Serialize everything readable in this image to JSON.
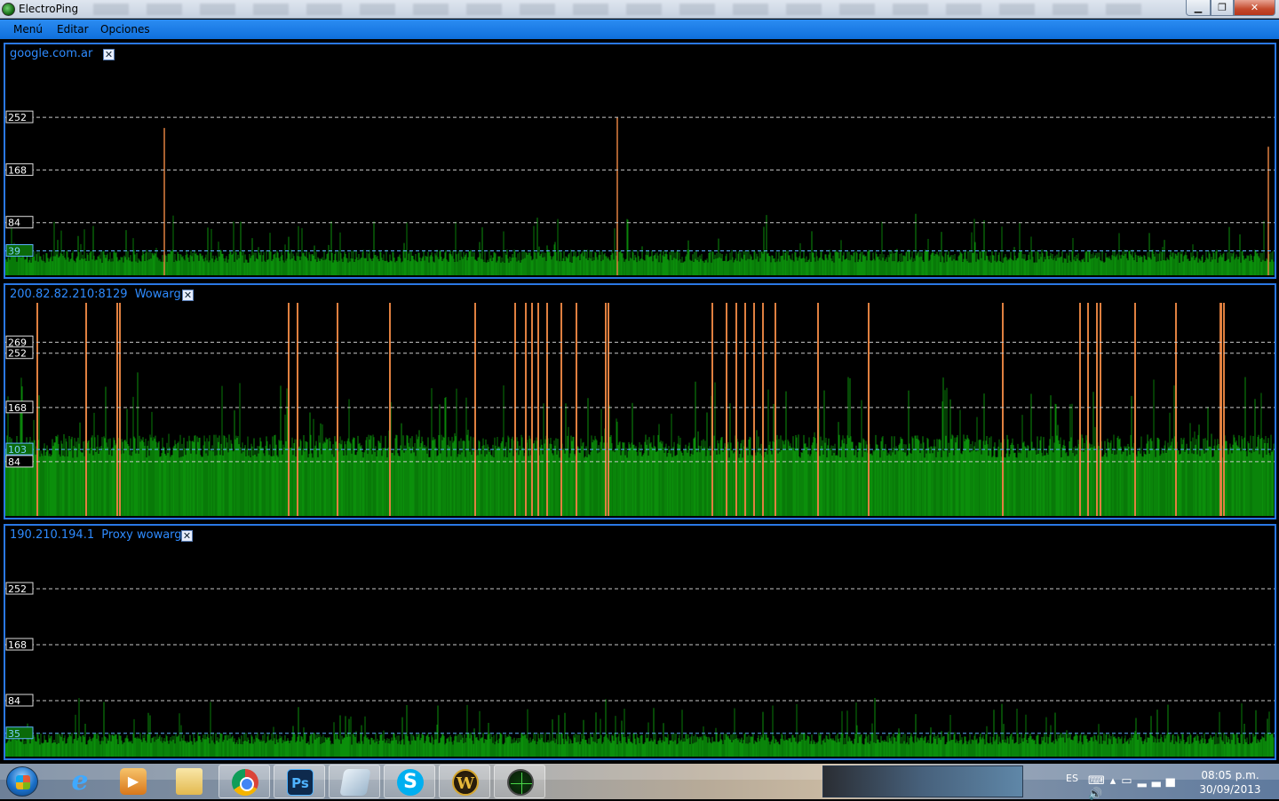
{
  "window": {
    "title": "ElectroPing"
  },
  "menu": {
    "items": [
      "Menú",
      "Editar",
      "Opciones"
    ]
  },
  "panels": [
    {
      "host": "google.com.ar",
      "label": "",
      "y_ticks": [
        252,
        168,
        84
      ],
      "baseline_label": 39,
      "max_scale": 340,
      "bar_color": "#0a8a0a",
      "spike_color": "#e08040",
      "spikes": [
        {
          "x": 0.125,
          "v": 235
        },
        {
          "x": 0.482,
          "v": 252
        },
        {
          "x": 0.995,
          "v": 205
        }
      ],
      "base": 20,
      "noise": 35,
      "seed": 7
    },
    {
      "host": "200.82.82.210:8129",
      "label": "Wowarg",
      "y_ticks": [
        269,
        252,
        168,
        84
      ],
      "baseline_label": 103,
      "max_scale": 330,
      "bar_color": "#0a8a0a",
      "spike_color": "#e08040",
      "spikes": [],
      "base": 90,
      "noise": 60,
      "seed": 3
    },
    {
      "host": "190.210.194.1",
      "label": "Proxy wowarg",
      "y_ticks": [
        252,
        168,
        84
      ],
      "baseline_label": 35,
      "max_scale": 320,
      "bar_color": "#0a8a0a",
      "spike_color": "#e08040",
      "spikes": [],
      "base": 18,
      "noise": 30,
      "seed": 11
    }
  ],
  "panel2_spike_positions": [
    0.025,
    0.064,
    0.088,
    0.09,
    0.223,
    0.23,
    0.262,
    0.303,
    0.37,
    0.402,
    0.41,
    0.415,
    0.42,
    0.427,
    0.438,
    0.45,
    0.473,
    0.475,
    0.557,
    0.568,
    0.576,
    0.583,
    0.59,
    0.597,
    0.607,
    0.64,
    0.68,
    0.786,
    0.847,
    0.853,
    0.86,
    0.863,
    0.89,
    0.922,
    0.957,
    0.958,
    0.96
  ],
  "taskbar": {
    "apps": [
      "Internet Explorer",
      "Media Player",
      "Explorador",
      "Chrome",
      "Photoshop",
      "Notas",
      "Skype",
      "World of Warcraft",
      "ElectroPing"
    ],
    "language": "ES",
    "time": "08:05 p.m.",
    "date": "30/09/2013"
  }
}
